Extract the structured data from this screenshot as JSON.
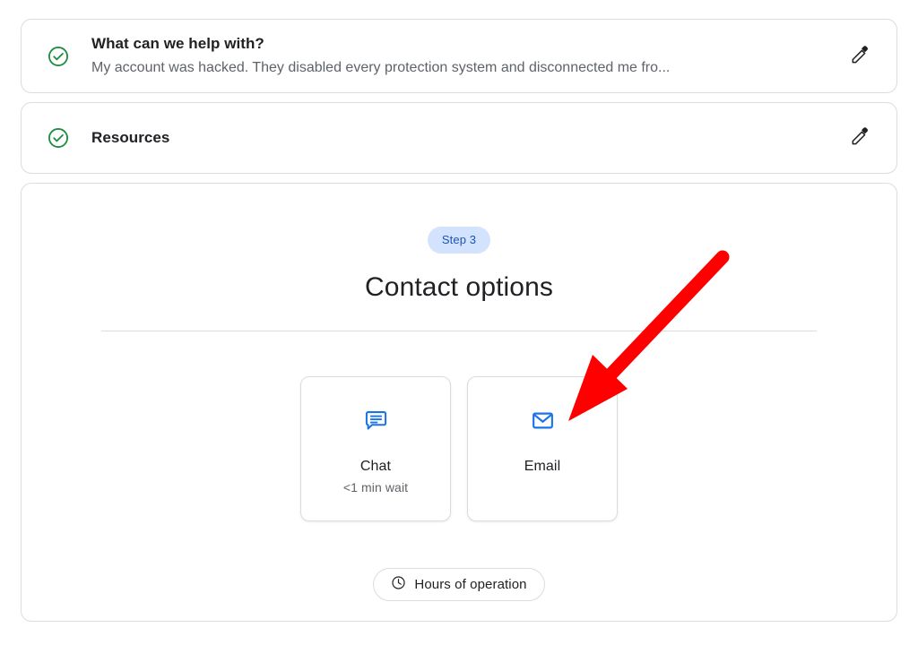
{
  "colors": {
    "accent_blue": "#1a73e8",
    "badge_bg": "#d3e3fd",
    "badge_text": "#1b54b5",
    "check_green": "#1e8e3e",
    "border_gray": "#dadce0",
    "text_primary": "#202124",
    "text_secondary": "#5f6368",
    "annotation_red": "#ff0000"
  },
  "steps": [
    {
      "icon": "check-circle-icon",
      "title": "What can we help with?",
      "summary": "My account was hacked. They disabled every protection system and disconnected me fro...",
      "edit_icon": "pencil-icon"
    },
    {
      "icon": "check-circle-icon",
      "title": "Resources",
      "edit_icon": "pencil-icon"
    }
  ],
  "contact": {
    "badge": "Step 3",
    "title": "Contact options",
    "options": [
      {
        "icon": "chat-bubble-icon",
        "label": "Chat",
        "wait": "<1 min wait"
      },
      {
        "icon": "email-envelope-icon",
        "label": "Email",
        "wait": ""
      }
    ],
    "hours_button": {
      "icon": "clock-icon",
      "label": "Hours of operation"
    }
  },
  "annotation": {
    "type": "arrow",
    "color": "#ff0000",
    "points_to": "email-option-card"
  }
}
